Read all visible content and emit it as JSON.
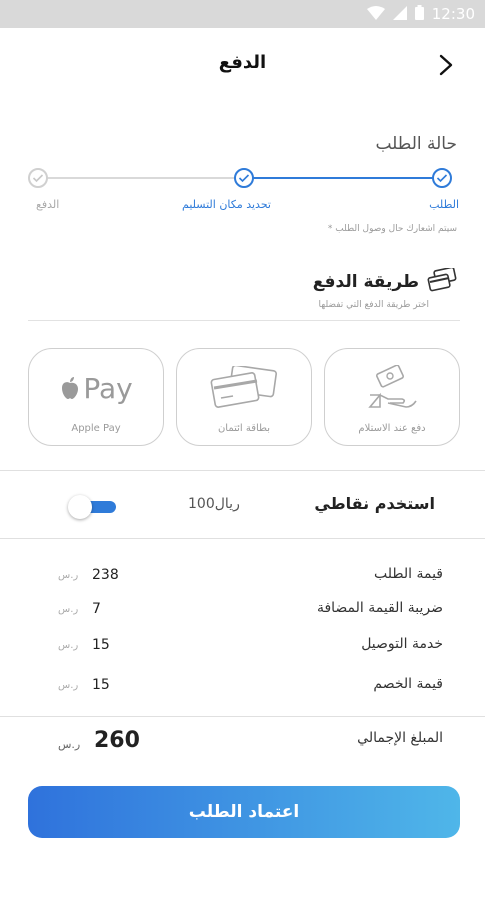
{
  "status_bar": {
    "time": "12:30"
  },
  "header": {
    "title": "الدفع"
  },
  "order_status": {
    "title": "حالة الطلب",
    "steps": [
      {
        "label": "الطلب",
        "state": "done"
      },
      {
        "label": "تحديد مكان التسليم",
        "state": "done"
      },
      {
        "label": "الدفع",
        "state": "pending"
      }
    ],
    "note": "* سيتم اشعارك حال وصول الطلب"
  },
  "payment": {
    "title": "طريقة الدفع",
    "subtitle": "اختر طريقة الدفع التي تفضلها",
    "icon": "credit-cards-icon",
    "methods": [
      {
        "label": "دفع عند الاستلام",
        "icon": "cash-hand-icon"
      },
      {
        "label": "بطاقة ائتمان",
        "icon": "credit-card-icon"
      },
      {
        "label": "Apple Pay",
        "icon": "apple-pay-icon",
        "mark": "Pay"
      }
    ]
  },
  "points": {
    "label": "استخدم نقاطي",
    "value": "100ريال",
    "enabled": true
  },
  "summary": {
    "currency": "ر.س",
    "rows": [
      {
        "label": "قيمة الطلب",
        "value": "238"
      },
      {
        "label": "ضريبة القيمة المضافة",
        "value": "7"
      },
      {
        "label": "خدمة التوصيل",
        "value": "15"
      },
      {
        "label": "قيمة الخصم",
        "value": "15"
      }
    ],
    "total_label": "المبلغ الإجمالي",
    "total_value": "260"
  },
  "confirm_button": {
    "label": "اعتماد الطلب"
  },
  "colors": {
    "accent": "#2f7bd9",
    "gradient_start": "#2f72dc",
    "gradient_end": "#4fb6e9",
    "inactive": "#d0d0d0"
  }
}
